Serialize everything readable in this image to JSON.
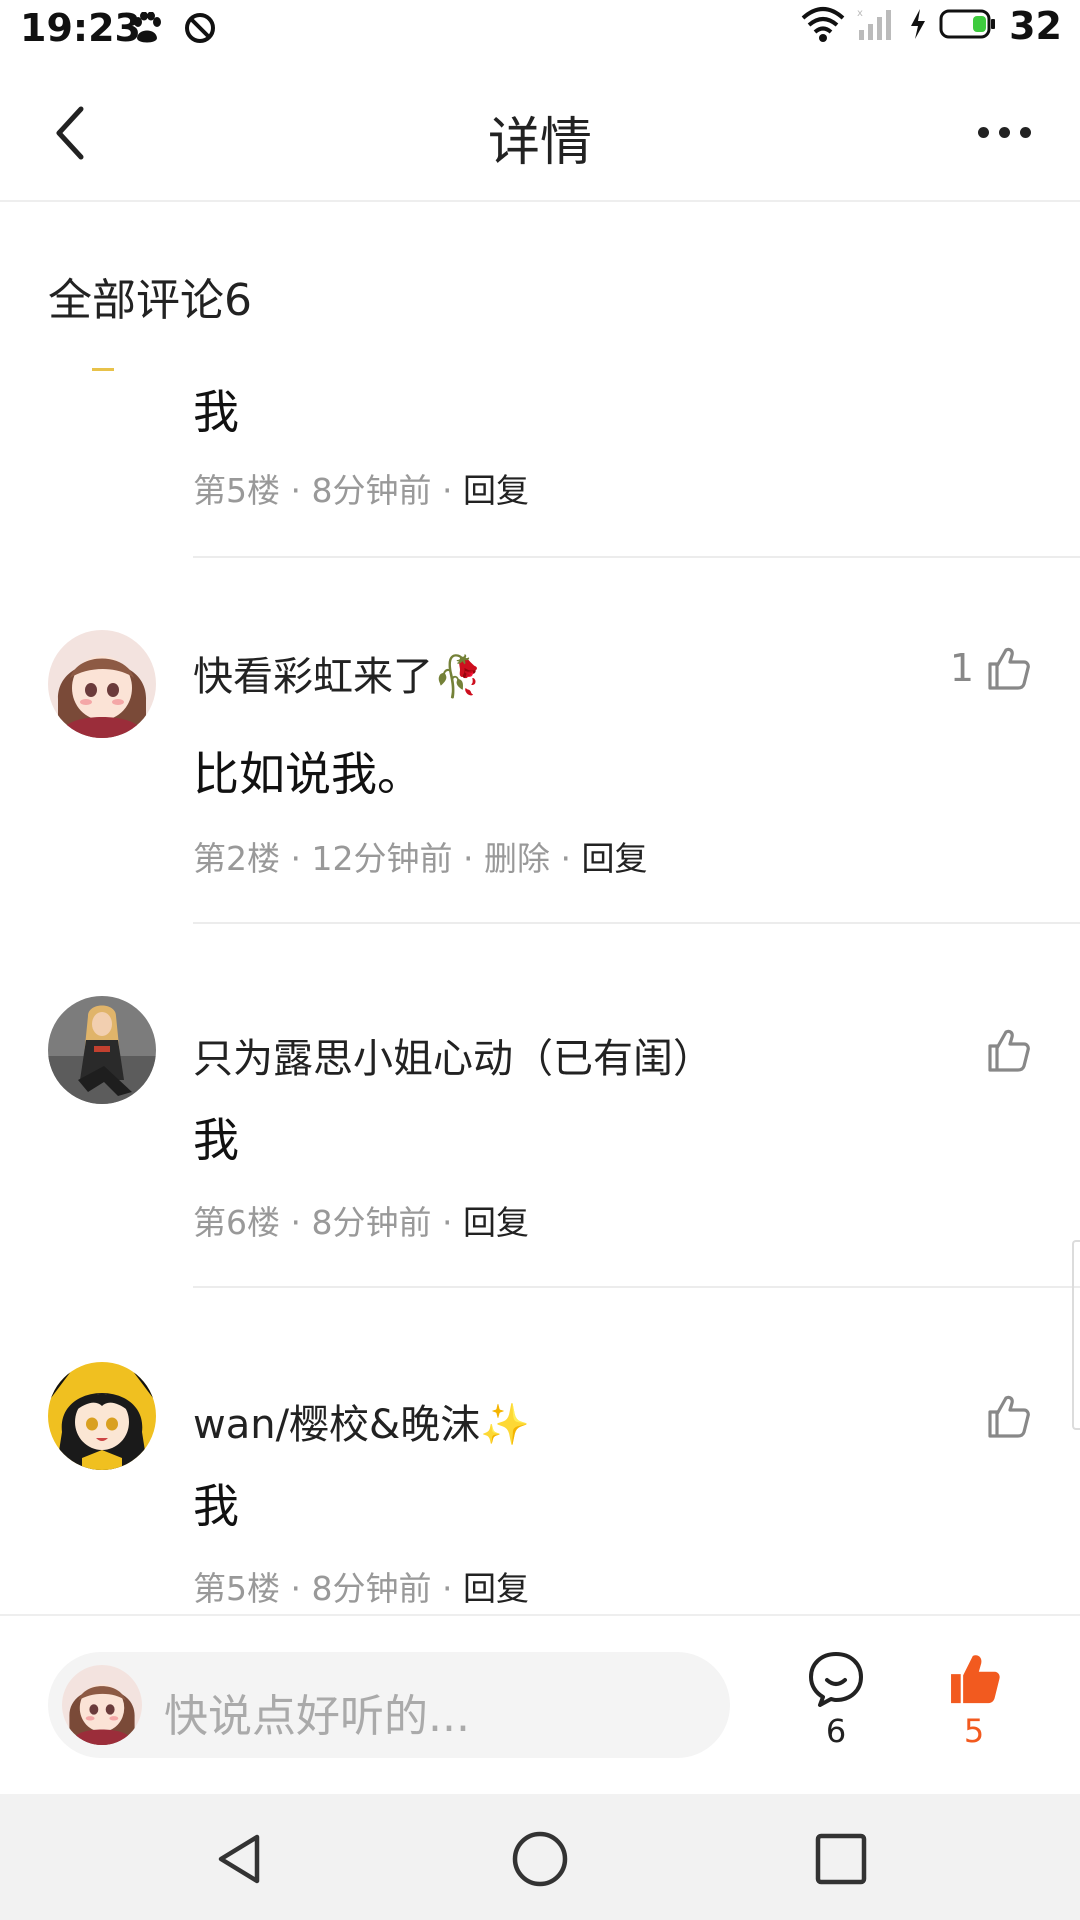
{
  "status_bar": {
    "time": "19:23",
    "battery_level": "32",
    "icons": [
      "baidu-paw-icon",
      "no-disturb-icon",
      "wifi-icon",
      "signal-icon",
      "charging-icon",
      "battery-icon"
    ]
  },
  "header": {
    "title": "详情",
    "back_icon": "chevron-left-icon",
    "more_icon": "more-dots-icon"
  },
  "comments": {
    "heading": "全部评论6",
    "items": [
      {
        "name": "",
        "body": "我",
        "floor": "第5楼",
        "time": "8分钟前",
        "delete": "",
        "reply": "回复",
        "likes": ""
      },
      {
        "name": "快看彩虹来了🥀",
        "body": "比如说我。",
        "floor": "第2楼",
        "time": "12分钟前",
        "delete": "删除",
        "reply": "回复",
        "likes": "1"
      },
      {
        "name": "只为露思小姐心动（已有闺）",
        "body": "我",
        "floor": "第6楼",
        "time": "8分钟前",
        "delete": "",
        "reply": "回复",
        "likes": ""
      },
      {
        "name": "wan/樱校&晚沫✨",
        "body": "我",
        "floor": "第5楼",
        "time": "8分钟前",
        "delete": "",
        "reply": "回复",
        "likes": ""
      }
    ]
  },
  "bottom_bar": {
    "input_placeholder": "快说点好听的...",
    "comment_count": "6",
    "like_count": "5",
    "like_color": "#f25a1f"
  },
  "nav_bar": {
    "icons": [
      "back-triangle-icon",
      "home-circle-icon",
      "recents-square-icon"
    ]
  }
}
